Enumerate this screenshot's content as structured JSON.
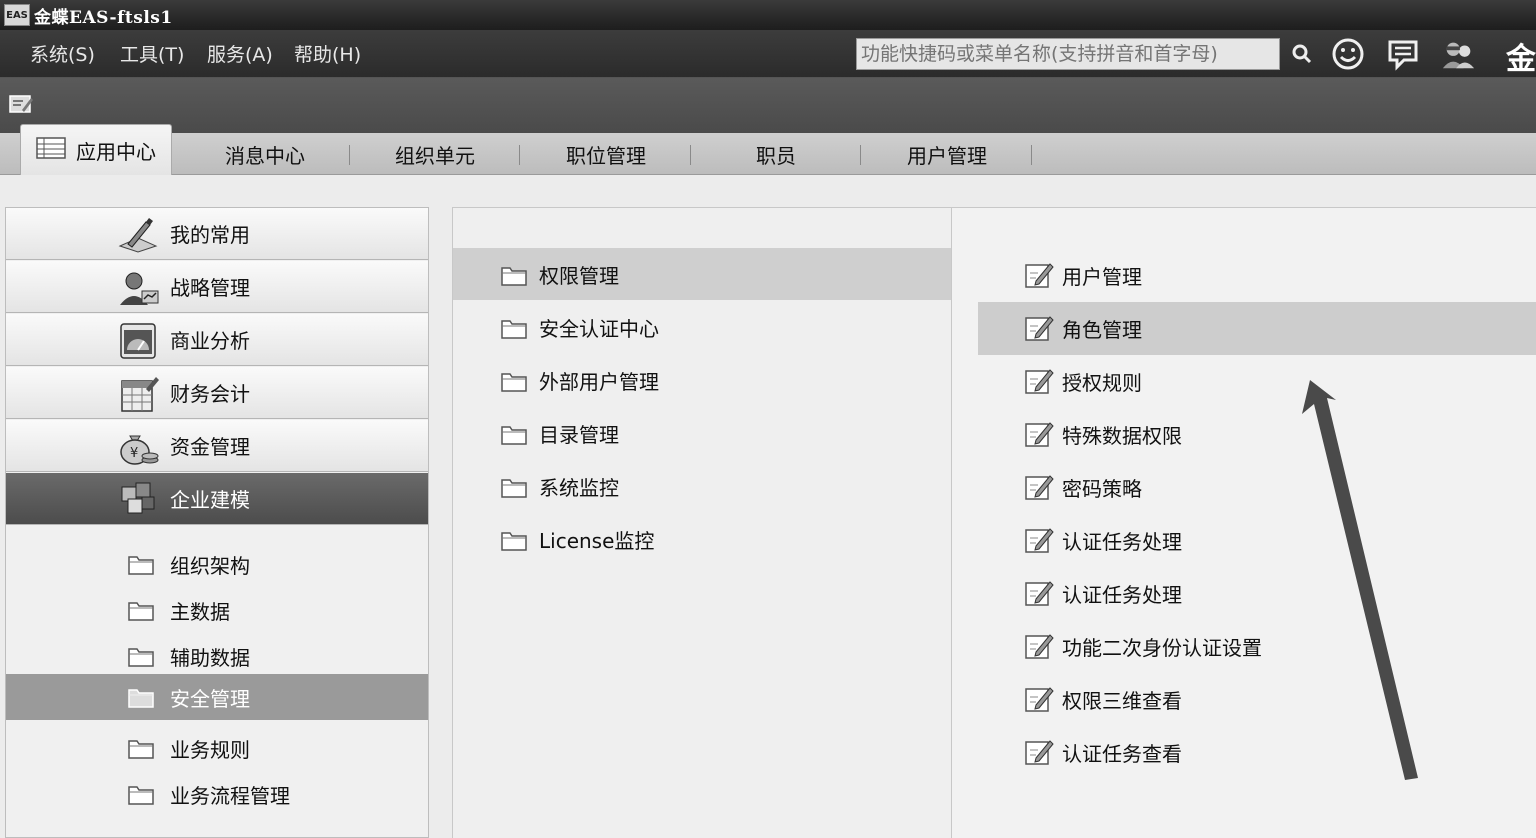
{
  "window": {
    "logo_text": "EAS",
    "title": "金蝶EAS-ftsls1"
  },
  "menubar": {
    "items": [
      "系统(S)",
      "工具(T)",
      "服务(A)",
      "帮助(H)"
    ],
    "search_placeholder": "功能快捷码或菜单名称(支持拼音和首字母)",
    "brand_glyph": "金"
  },
  "tabs": [
    {
      "label": "应用中心",
      "active": true
    },
    {
      "label": "消息中心",
      "active": false
    },
    {
      "label": "组织单元",
      "active": false
    },
    {
      "label": "职位管理",
      "active": false
    },
    {
      "label": "职员",
      "active": false
    },
    {
      "label": "用户管理",
      "active": false
    }
  ],
  "left": {
    "categories": [
      {
        "label": "我的常用",
        "icon": "pen-desk-icon"
      },
      {
        "label": "战略管理",
        "icon": "person-icon"
      },
      {
        "label": "商业分析",
        "icon": "dashboard-icon"
      },
      {
        "label": "财务会计",
        "icon": "calendar-icon"
      },
      {
        "label": "资金管理",
        "icon": "money-bag-icon"
      },
      {
        "label": "企业建模",
        "icon": "cubes-icon",
        "active": true
      }
    ],
    "subitems": [
      {
        "label": "组织架构"
      },
      {
        "label": "主数据"
      },
      {
        "label": "辅助数据"
      },
      {
        "label": "安全管理",
        "active": true
      },
      {
        "label": "业务规则"
      },
      {
        "label": "业务流程管理"
      }
    ]
  },
  "middle": {
    "items": [
      {
        "label": "权限管理",
        "active": true
      },
      {
        "label": "安全认证中心"
      },
      {
        "label": "外部用户管理"
      },
      {
        "label": "目录管理"
      },
      {
        "label": "系统监控"
      },
      {
        "label": "License监控"
      }
    ]
  },
  "right": {
    "items": [
      {
        "label": "用户管理"
      },
      {
        "label": "角色管理",
        "active": true
      },
      {
        "label": "授权规则"
      },
      {
        "label": "特殊数据权限"
      },
      {
        "label": "密码策略"
      },
      {
        "label": "认证任务处理"
      },
      {
        "label": "认证任务处理"
      },
      {
        "label": "功能二次身份认证设置"
      },
      {
        "label": "权限三维查看"
      },
      {
        "label": "认证任务查看"
      }
    ]
  }
}
